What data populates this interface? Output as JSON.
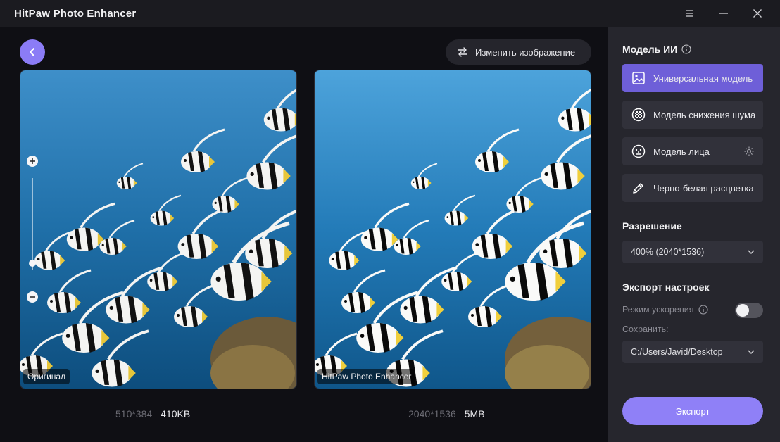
{
  "app": {
    "title": "HitPaw Photo Enhancer"
  },
  "toolbar": {
    "change_image_label": "Изменить изображение"
  },
  "preview": {
    "original": {
      "label": "Оригинал",
      "dimensions": "510*384",
      "size": "410KB"
    },
    "enhanced": {
      "label": "HitPaw Photo Enhancer",
      "dimensions": "2040*1536",
      "size": "5MB"
    }
  },
  "sidebar": {
    "ai_model": {
      "title": "Модель ИИ",
      "models": [
        {
          "label": "Универсальная модель",
          "icon": "image-icon",
          "active": true
        },
        {
          "label": "Модель снижения шума",
          "icon": "denoise-icon",
          "active": false
        },
        {
          "label": "Модель лица",
          "icon": "face-icon",
          "active": false
        },
        {
          "label": "Черно-белая расцветка",
          "icon": "colorize-icon",
          "active": false
        }
      ]
    },
    "resolution": {
      "title": "Разрешение",
      "selected": "400% (2040*1536)"
    },
    "export_settings": {
      "title": "Экспорт настроек",
      "acceleration_label": "Режим ускорения",
      "acceleration_on": false,
      "save_label": "Сохранить:",
      "save_path": "C:/Users/Javid/Desktop"
    },
    "export_button": "Экспорт"
  },
  "colors": {
    "accent": "#8f80f7",
    "accent_active": "#6e5fd8",
    "sidebar_bg": "#26262d"
  }
}
